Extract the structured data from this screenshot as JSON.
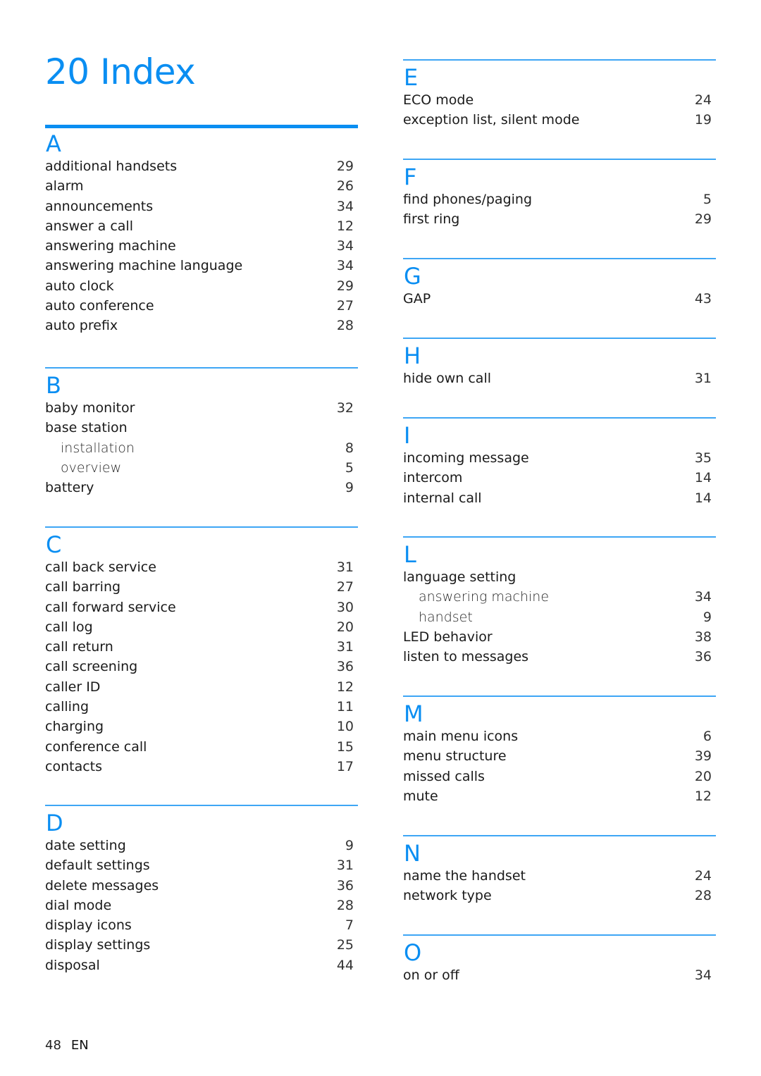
{
  "page": {
    "title": "20 Index",
    "accent_color": "#0a8ef2",
    "rule_color": "#3ea6f5",
    "footer": {
      "page_number": "48",
      "language": "EN"
    }
  },
  "left_column": [
    {
      "letter": "A",
      "entries": [
        {
          "term": "additional handsets",
          "page": "29",
          "sub": false
        },
        {
          "term": "alarm",
          "page": "26",
          "sub": false
        },
        {
          "term": "announcements",
          "page": "34",
          "sub": false
        },
        {
          "term": "answer a call",
          "page": "12",
          "sub": false
        },
        {
          "term": "answering machine",
          "page": "34",
          "sub": false
        },
        {
          "term": "answering machine language",
          "page": "34",
          "sub": false
        },
        {
          "term": "auto clock",
          "page": "29",
          "sub": false
        },
        {
          "term": "auto conference",
          "page": "27",
          "sub": false
        },
        {
          "term": "auto prefix",
          "page": "28",
          "sub": false
        }
      ]
    },
    {
      "letter": "B",
      "entries": [
        {
          "term": "baby monitor",
          "page": "32",
          "sub": false
        },
        {
          "term": "base station",
          "page": "",
          "sub": false
        },
        {
          "term": "installation",
          "page": "8",
          "sub": true
        },
        {
          "term": "overview",
          "page": "5",
          "sub": true
        },
        {
          "term": "battery",
          "page": "9",
          "sub": false
        }
      ]
    },
    {
      "letter": "C",
      "entries": [
        {
          "term": "call back service",
          "page": "31",
          "sub": false
        },
        {
          "term": "call barring",
          "page": "27",
          "sub": false
        },
        {
          "term": "call forward service",
          "page": "30",
          "sub": false
        },
        {
          "term": "call log",
          "page": "20",
          "sub": false
        },
        {
          "term": "call return",
          "page": "31",
          "sub": false
        },
        {
          "term": "call screening",
          "page": "36",
          "sub": false
        },
        {
          "term": "caller ID",
          "page": "12",
          "sub": false
        },
        {
          "term": "calling",
          "page": "11",
          "sub": false
        },
        {
          "term": "charging",
          "page": "10",
          "sub": false
        },
        {
          "term": "conference call",
          "page": "15",
          "sub": false
        },
        {
          "term": "contacts",
          "page": "17",
          "sub": false
        }
      ]
    },
    {
      "letter": "D",
      "entries": [
        {
          "term": "date setting",
          "page": "9",
          "sub": false
        },
        {
          "term": "default settings",
          "page": "31",
          "sub": false
        },
        {
          "term": "delete messages",
          "page": "36",
          "sub": false
        },
        {
          "term": "dial mode",
          "page": "28",
          "sub": false
        },
        {
          "term": "display icons",
          "page": "7",
          "sub": false
        },
        {
          "term": "display settings",
          "page": "25",
          "sub": false
        },
        {
          "term": "disposal",
          "page": "44",
          "sub": false
        }
      ]
    }
  ],
  "right_column": [
    {
      "letter": "E",
      "entries": [
        {
          "term": "ECO mode",
          "page": "24",
          "sub": false
        },
        {
          "term": "exception list, silent mode",
          "page": "19",
          "sub": false
        }
      ]
    },
    {
      "letter": "F",
      "entries": [
        {
          "term": "find phones/paging",
          "page": "5",
          "sub": false
        },
        {
          "term": "first ring",
          "page": "29",
          "sub": false
        }
      ]
    },
    {
      "letter": "G",
      "entries": [
        {
          "term": "GAP",
          "page": "43",
          "sub": false
        }
      ]
    },
    {
      "letter": "H",
      "entries": [
        {
          "term": "hide own call",
          "page": "31",
          "sub": false
        }
      ]
    },
    {
      "letter": "I",
      "entries": [
        {
          "term": "incoming message",
          "page": "35",
          "sub": false
        },
        {
          "term": "intercom",
          "page": "14",
          "sub": false
        },
        {
          "term": "internal call",
          "page": "14",
          "sub": false
        }
      ]
    },
    {
      "letter": "L",
      "entries": [
        {
          "term": "language setting",
          "page": "",
          "sub": false
        },
        {
          "term": "answering machine",
          "page": "34",
          "sub": true
        },
        {
          "term": "handset",
          "page": "9",
          "sub": true
        },
        {
          "term": "LED behavior",
          "page": "38",
          "sub": false
        },
        {
          "term": "listen to messages",
          "page": "36",
          "sub": false
        }
      ]
    },
    {
      "letter": "M",
      "entries": [
        {
          "term": "main menu icons",
          "page": "6",
          "sub": false
        },
        {
          "term": "menu structure",
          "page": "39",
          "sub": false
        },
        {
          "term": "missed calls",
          "page": "20",
          "sub": false
        },
        {
          "term": "mute",
          "page": "12",
          "sub": false
        }
      ]
    },
    {
      "letter": "N",
      "entries": [
        {
          "term": "name the handset",
          "page": "24",
          "sub": false
        },
        {
          "term": "network type",
          "page": "28",
          "sub": false
        }
      ]
    },
    {
      "letter": "O",
      "entries": [
        {
          "term": "on or off",
          "page": "34",
          "sub": false
        }
      ]
    }
  ]
}
